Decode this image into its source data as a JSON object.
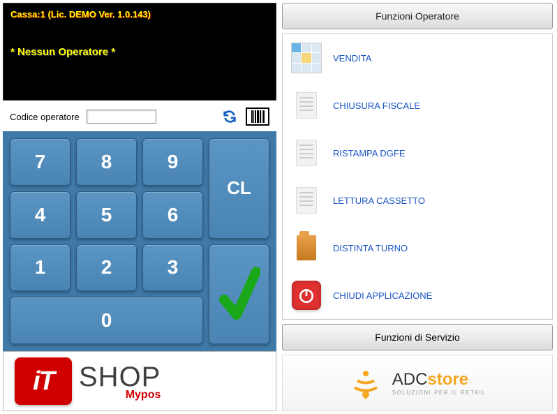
{
  "display": {
    "title": "Cassa:1 (Lic. DEMO Ver. 1.0.143)",
    "status": "* Nessun Operatore *"
  },
  "operator": {
    "label": "Codice operatore",
    "value": ""
  },
  "keypad": {
    "k7": "7",
    "k8": "8",
    "k9": "9",
    "k4": "4",
    "k5": "5",
    "k6": "6",
    "k1": "1",
    "k2": "2",
    "k3": "3",
    "k0": "0",
    "clear": "CL"
  },
  "logo_left": {
    "badge": "iT",
    "line1": "SHOP",
    "line2": "Mypos"
  },
  "right": {
    "header_operator": "Funzioni Operatore",
    "header_service": "Funzioni di Servizio",
    "items": [
      {
        "label": "VENDITA",
        "icon": "grid-thumb"
      },
      {
        "label": "CHIUSURA FISCALE",
        "icon": "receipt-icon"
      },
      {
        "label": "RISTAMPA DGFE",
        "icon": "receipt-icon"
      },
      {
        "label": "LETTURA CASSETTO",
        "icon": "receipt-icon"
      },
      {
        "label": "DISTINTA TURNO",
        "icon": "folder-icon"
      },
      {
        "label": "CHIUDI APPLICAZIONE",
        "icon": "power-icon"
      }
    ]
  },
  "logo_right": {
    "brand_prefix": "ADC",
    "brand_suffix": "store",
    "tagline": "SOLUZIONI PER IL RETAIL"
  }
}
